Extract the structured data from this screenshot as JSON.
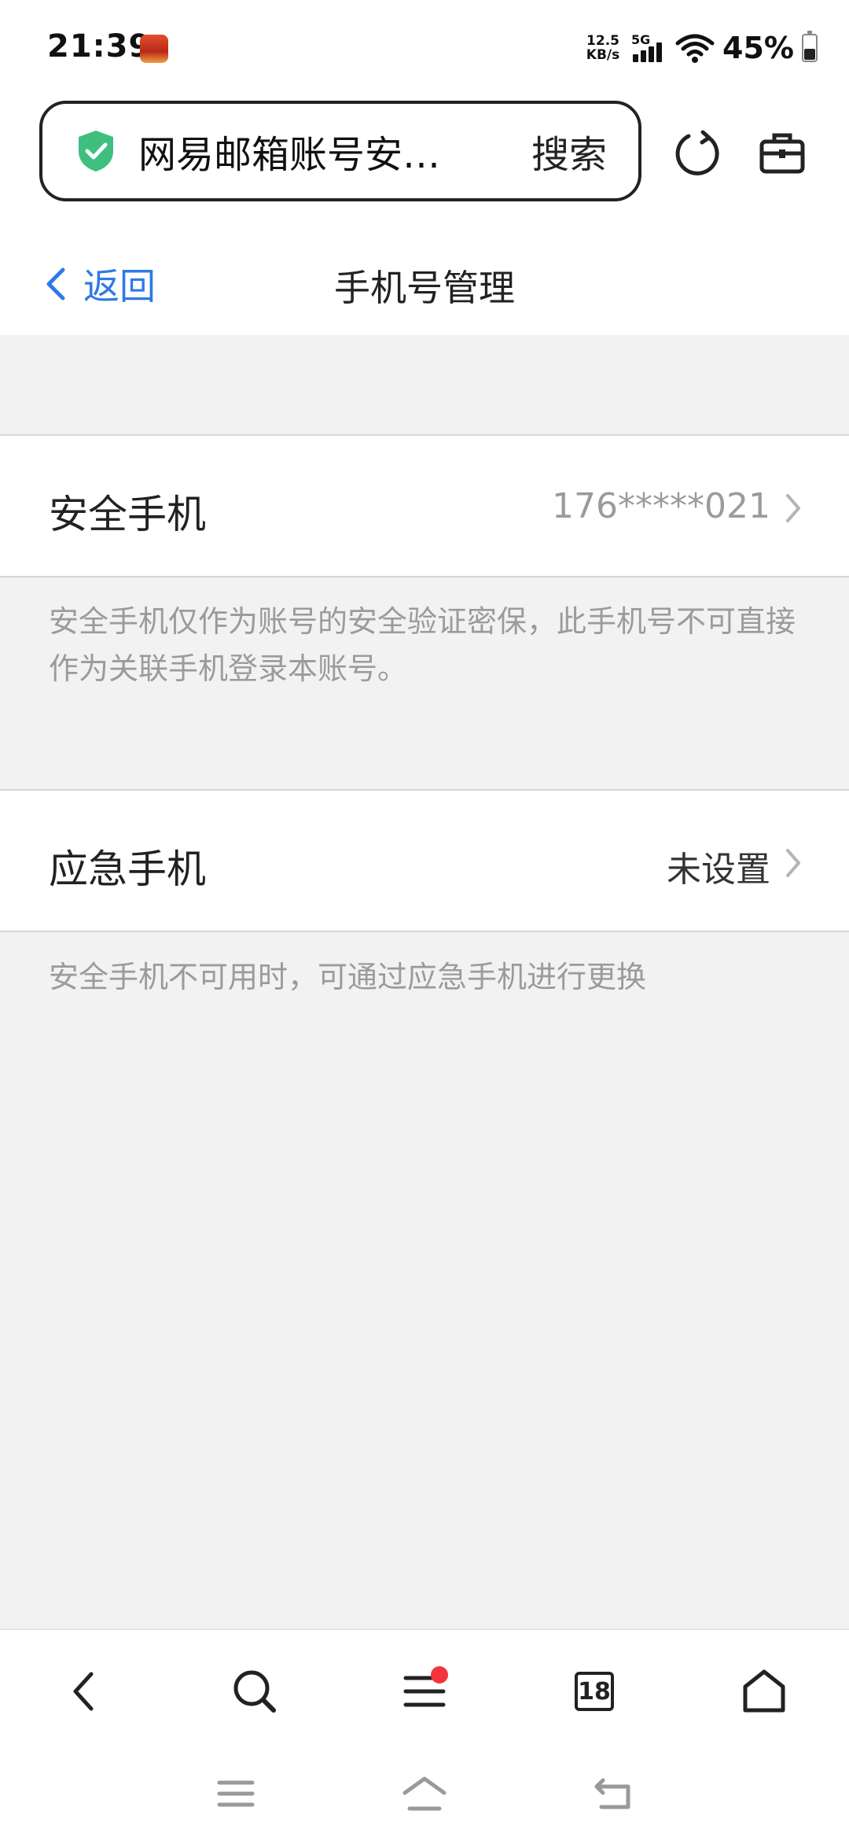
{
  "status_bar": {
    "time": "21:39",
    "net_speed_value": "12.5",
    "net_speed_unit": "KB/s",
    "network_type": "5G",
    "battery_percent": "45%",
    "battery_level": 0.45
  },
  "browser": {
    "address_title": "网易邮箱账号安…",
    "search_label": "搜索",
    "shield_color": "#3fbf7f"
  },
  "nav": {
    "back_label": "返回",
    "title": "手机号管理",
    "accent_color": "#2f7ae5"
  },
  "settings": [
    {
      "label": "安全手机",
      "value": "176*****021",
      "value_color": "#9b9b9b",
      "hint": "安全手机仅作为账号的安全验证密保，此手机号不可直接作为关联手机登录本账号。"
    },
    {
      "label": "应急手机",
      "value": "未设置",
      "value_color": "#333333",
      "hint": "安全手机不可用时，可通过应急手机进行更换"
    }
  ],
  "toolbar": {
    "tab_count": "18",
    "menu_badge_color": "#f5333f"
  }
}
